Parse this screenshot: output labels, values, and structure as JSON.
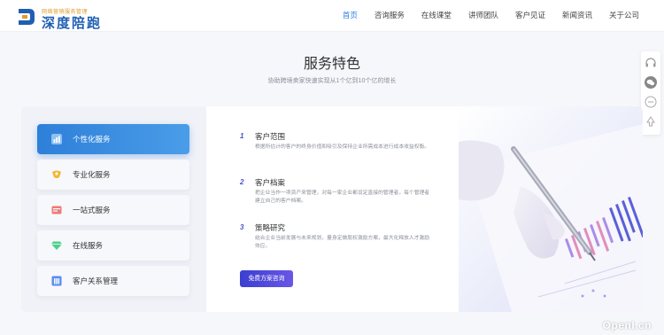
{
  "brand": {
    "subtitle": "网络营销服务管理",
    "name": "深度陪跑",
    "logo_icon": "brand-logo-mark"
  },
  "nav": {
    "items": [
      {
        "label": "首页",
        "active": true
      },
      {
        "label": "咨询服务",
        "active": false
      },
      {
        "label": "在线课堂",
        "active": false
      },
      {
        "label": "讲师团队",
        "active": false
      },
      {
        "label": "客户见证",
        "active": false
      },
      {
        "label": "新闻资讯",
        "active": false
      },
      {
        "label": "关于公司",
        "active": false
      }
    ]
  },
  "section": {
    "title": "服务特色",
    "subtitle": "协助跨境卖家快速实现从1个亿到10个亿的增长"
  },
  "tabs": [
    {
      "label": "个性化服务",
      "icon": "chart-icon",
      "active": true
    },
    {
      "label": "专业化服务",
      "icon": "badge-icon",
      "active": false
    },
    {
      "label": "一站式服务",
      "icon": "card-icon",
      "active": false
    },
    {
      "label": "在线服务",
      "icon": "diamond-icon",
      "active": false
    },
    {
      "label": "客户关系管理",
      "icon": "building-icon",
      "active": false
    }
  ],
  "features": [
    {
      "num": "1",
      "title": "客户范围",
      "desc": "根据所估计的客户的终身价值和吸引及保持企业所需成本进行成本收益权衡。"
    },
    {
      "num": "2",
      "title": "客户档案",
      "desc": "把企业当作一项资产来管理，对每一家企业都设定直接的管理者，每个管理者建立自己的客户档案。"
    },
    {
      "num": "3",
      "title": "策略研究",
      "desc": "结合企业当前发展与未来规划，量身定做股权激励方案，最大化释放人才激励效应。"
    }
  ],
  "cta": {
    "label": "免费方案咨询"
  },
  "watermark": "OpenI.cn",
  "colors": {
    "accent": "#2f7fe0",
    "tab_active": "#2e7fd9",
    "cta": "#4a46d8"
  }
}
